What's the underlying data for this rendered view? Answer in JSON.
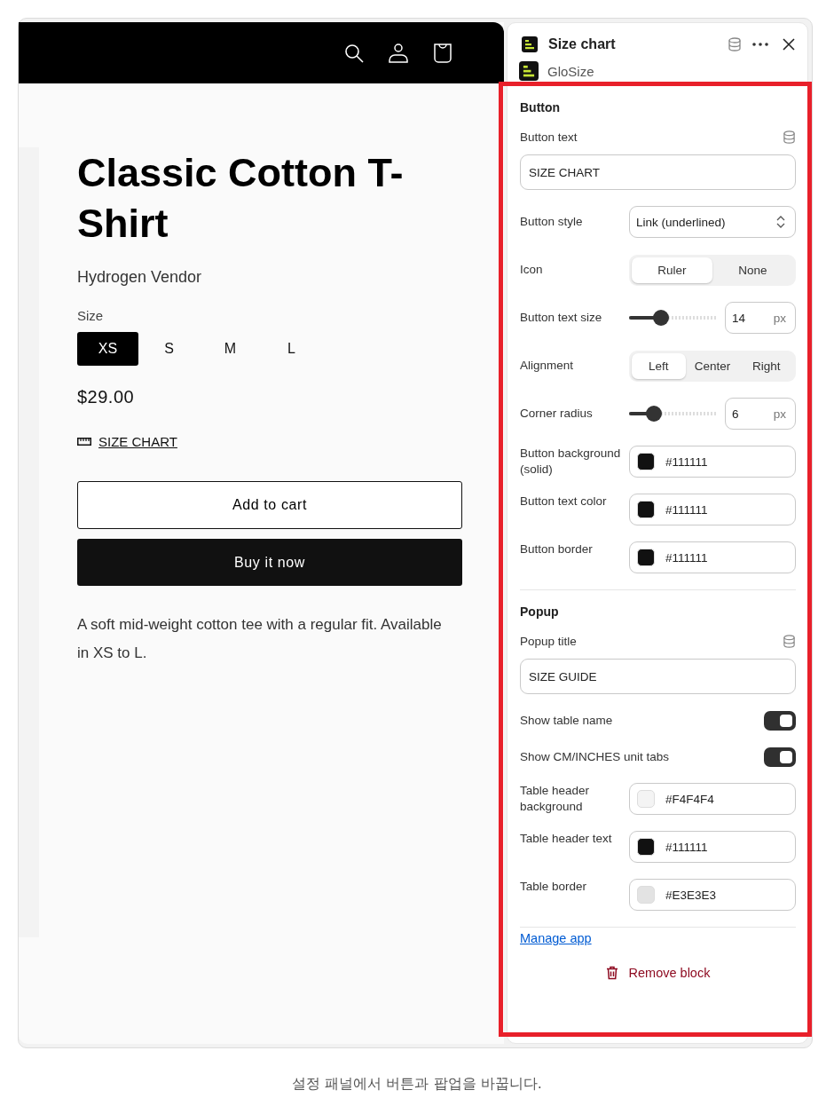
{
  "store": {
    "product_title": "Classic Cotton T-Shirt",
    "vendor": "Hydrogen Vendor",
    "size_label": "Size",
    "sizes": [
      {
        "label": "XS",
        "selected": true
      },
      {
        "label": "S",
        "selected": false
      },
      {
        "label": "M",
        "selected": false
      },
      {
        "label": "L",
        "selected": false
      }
    ],
    "price": "$29.00",
    "size_chart_link": "SIZE CHART",
    "add_to_cart": "Add to cart",
    "buy_now": "Buy it now",
    "description": "A soft mid-weight cotton tee with a regular fit. Available in XS to L."
  },
  "panel": {
    "title": "Size chart",
    "app_name": "GloSize",
    "settings": [
      {
        "kind": "heading",
        "label": "Button"
      },
      {
        "kind": "text",
        "label": "Button text",
        "value": "SIZE CHART"
      },
      {
        "kind": "select",
        "label": "Button style",
        "value": "Link (underlined)"
      },
      {
        "kind": "segmented",
        "label": "Icon",
        "options": [
          {
            "label": "Ruler",
            "selected": true
          },
          {
            "label": "None",
            "selected": false
          }
        ]
      },
      {
        "kind": "slider",
        "label": "Button text size",
        "level": 0.36,
        "value": "14",
        "unit": "px"
      },
      {
        "kind": "segmented",
        "label": "Alignment",
        "options": [
          {
            "label": "Left",
            "selected": true
          },
          {
            "label": "Center",
            "selected": false
          },
          {
            "label": "Right",
            "selected": false
          }
        ]
      },
      {
        "kind": "slider",
        "label": "Corner radius",
        "level": 0.28,
        "value": "6",
        "unit": "px"
      },
      {
        "kind": "color",
        "label": "Button background (solid)",
        "value": "#111111",
        "color": "#111111"
      },
      {
        "kind": "color",
        "label": "Button text color",
        "value": "#111111",
        "color": "#111111"
      },
      {
        "kind": "color",
        "label": "Button border",
        "value": "#111111",
        "color": "#111111"
      },
      {
        "kind": "divider"
      },
      {
        "kind": "heading",
        "label": "Popup"
      },
      {
        "kind": "text",
        "label": "Popup title",
        "value": "SIZE GUIDE"
      },
      {
        "kind": "toggle",
        "label": "Show table name",
        "on": true
      },
      {
        "kind": "toggle",
        "label": "Show CM/INCHES unit tabs",
        "on": true
      },
      {
        "kind": "color",
        "label": "Table header background",
        "value": "#F4F4F4",
        "color": "#f4f4f4"
      },
      {
        "kind": "color",
        "label": "Table header text",
        "value": "#111111",
        "color": "#111111"
      },
      {
        "kind": "color",
        "label": "Table border",
        "value": "#E3E3E3",
        "color": "#e3e3e3"
      }
    ],
    "manage_link": "Manage app",
    "remove_button": "Remove block"
  },
  "caption": "설정 패널에서 버튼과 팝업을 바꿉니다."
}
